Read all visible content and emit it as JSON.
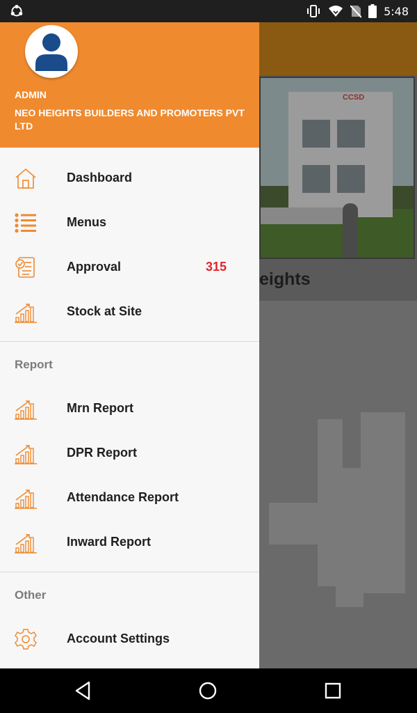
{
  "status_bar": {
    "time": "5:48",
    "icons": [
      "sync-icon",
      "vibrate-icon",
      "wifi-icon",
      "no-sim-icon",
      "battery-icon"
    ]
  },
  "background_app": {
    "title_fragment": "eights",
    "photo_logo": "CCSD"
  },
  "drawer": {
    "header": {
      "role": "ADMIN",
      "company": "NEO HEIGHTS BUILDERS AND PROMOTERS PVT LTD",
      "avatar_icon": "person-icon"
    },
    "items": [
      {
        "label": "Dashboard",
        "icon": "home-icon"
      },
      {
        "label": "Menus",
        "icon": "list-icon"
      },
      {
        "label": "Approval",
        "icon": "approval-icon",
        "badge": "315"
      },
      {
        "label": "Stock at Site",
        "icon": "bar-chart-icon"
      }
    ],
    "report_section": {
      "title": "Report",
      "items": [
        {
          "label": "Mrn Report",
          "icon": "bar-chart-icon"
        },
        {
          "label": "DPR Report",
          "icon": "bar-chart-icon"
        },
        {
          "label": "Attendance Report",
          "icon": "bar-chart-icon"
        },
        {
          "label": "Inward Report",
          "icon": "bar-chart-icon"
        }
      ]
    },
    "other_section": {
      "title": "Other",
      "items": [
        {
          "label": "Account Settings",
          "icon": "gear-icon"
        }
      ]
    }
  },
  "nav_bar": {
    "buttons": [
      "back-icon",
      "home-circle-icon",
      "recents-icon"
    ]
  },
  "colors": {
    "accent": "#ef8a2f",
    "badge": "#e3252a",
    "drawer_bg": "#f7f7f7"
  }
}
